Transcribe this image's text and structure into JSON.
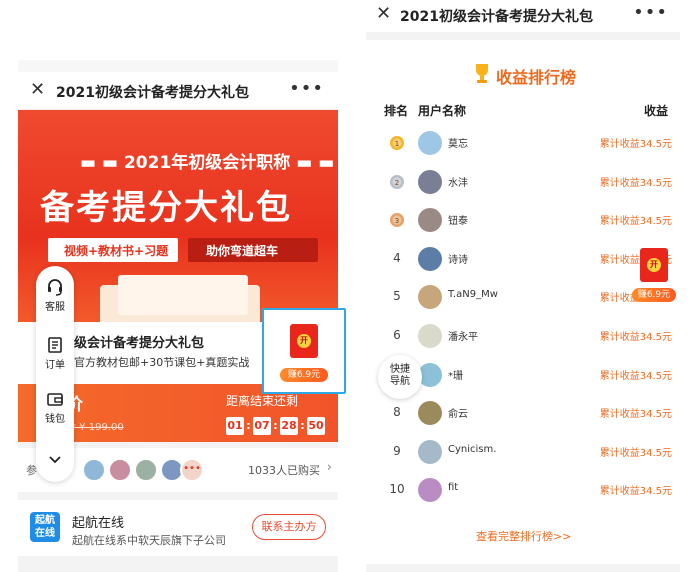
{
  "left": {
    "title": "2021初级会计备考提分大礼包",
    "banner": {
      "subtitle": "2021年初级会计职称",
      "headline": "备考提分大礼包",
      "chip1": "视频+教材书+习题",
      "chip2": "助你弯道超车"
    },
    "product": {
      "name": "级会计备考提分大礼包",
      "desc": "官方教材包邮+30节课包+真题实战"
    },
    "price": {
      "label": "价",
      "original": "价 ¥ 199.00",
      "countdown_label": "距离结束还剩",
      "timer": [
        "01",
        "07",
        "28",
        "50"
      ]
    },
    "buyers": {
      "label": "参 计",
      "count": "1033人已购买",
      "avatar_colors": [
        "#8fb8d8",
        "#c98e9e",
        "#9cb0a4",
        "#7d98c0"
      ]
    },
    "footer": {
      "logo_line1": "起航",
      "logo_line2": "在线",
      "name": "起航在线",
      "desc": "起航在线系中软天辰旗下子公司",
      "button": "联系主办方"
    },
    "side_menu": [
      {
        "icon": "headset-icon",
        "label": "客服"
      },
      {
        "icon": "order-icon",
        "label": "订单"
      },
      {
        "icon": "wallet-icon",
        "label": "钱包"
      }
    ],
    "packet": {
      "coin": "开",
      "earn": "赚6.9元"
    }
  },
  "right": {
    "title": "2021初级会计备考提分大礼包",
    "rank_title": "收益排行榜",
    "headers": {
      "rank": "排名",
      "user": "用户名称",
      "earnings": "收益"
    },
    "rows": [
      {
        "rank": "1",
        "medal": "gold",
        "name": "莫忘",
        "earn": "累计收益34.5元",
        "avatar": "#9ec7e6"
      },
      {
        "rank": "2",
        "medal": "silver",
        "name": "水沣",
        "earn": "累计收益34.5元",
        "avatar": "#7a7f96"
      },
      {
        "rank": "3",
        "medal": "bronze",
        "name": "钮泰",
        "earn": "累计收益34.5元",
        "avatar": "#9a8a86"
      },
      {
        "rank": "4",
        "medal": "",
        "name": "诗诗",
        "earn": "累计收益34.5元",
        "avatar": "#5c7ea6"
      },
      {
        "rank": "5",
        "medal": "",
        "name": "T.aN9_Mw",
        "earn": "累计收益34.5元",
        "avatar": "#c8a67c"
      },
      {
        "rank": "6",
        "medal": "",
        "name": "潘永平",
        "earn": "累计收益34.5元",
        "avatar": "#d9d9cc"
      },
      {
        "rank": "7",
        "medal": "",
        "name": "*珊",
        "earn": "累计收益34.5元",
        "avatar": "#8cc1d8"
      },
      {
        "rank": "8",
        "medal": "",
        "name": "俞云",
        "earn": "累计收益34.5元",
        "avatar": "#9b8a5c"
      },
      {
        "rank": "9",
        "medal": "",
        "name": "Cynicism.",
        "earn": "累计收益34.5元",
        "avatar": "#a6b9c9"
      },
      {
        "rank": "10",
        "medal": "",
        "name": "fit",
        "earn": "累计收益34.5元",
        "avatar": "#b98cc4"
      }
    ],
    "more_link": "查看完整排行榜>>",
    "quick_nav": {
      "line1": "快捷",
      "line2": "导航"
    },
    "packet": {
      "coin": "开",
      "earn": "赚6.9元"
    }
  },
  "colors": {
    "brand_red": "#e8321e",
    "accent_orange": "#f06a1e",
    "highlight_blue": "#2ea8e6"
  }
}
